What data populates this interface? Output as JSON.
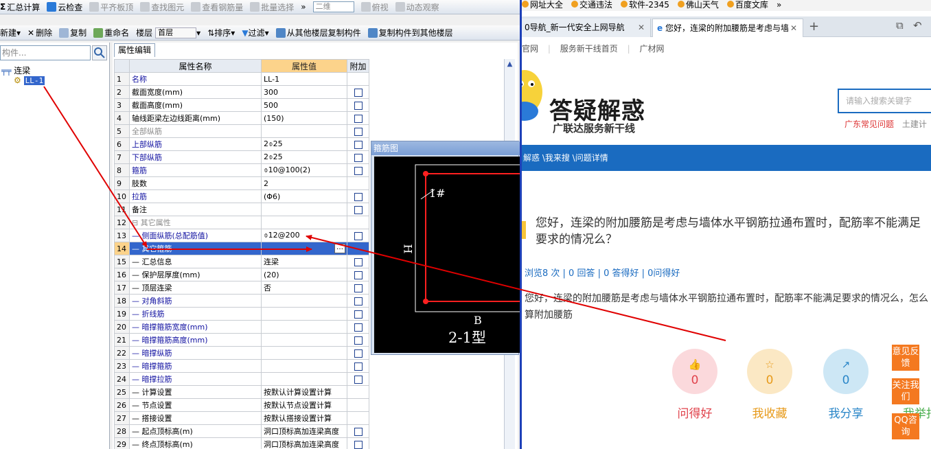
{
  "toolbar1": {
    "summary_calc": "汇总计算",
    "cloud_check": "云检查",
    "align_slab_top": "平齐板顶",
    "find_element": "查找图元",
    "view_rebar": "查看钢筋量",
    "batch_select": "批量选择",
    "more": "»",
    "view_mode": "二维",
    "top_view": "俯视",
    "dynamic_view": "动态观察"
  },
  "toolbar2": {
    "new": "新建",
    "delete": "删除",
    "copy": "复制",
    "rename": "重命名",
    "floor_label": "楼层",
    "floor_value": "首层",
    "sort": "排序",
    "filter": "过滤",
    "copy_from_floor": "从其他楼层复制构件",
    "copy_to_floor": "复制构件到其他楼层"
  },
  "tree": {
    "search_placeholder": "构件...",
    "root": "连梁",
    "child": "LL-1"
  },
  "property_editor": {
    "tab": "属性编辑",
    "headers": {
      "name": "属性名称",
      "value": "属性值",
      "extra": "附加"
    },
    "rows": [
      {
        "num": "1",
        "name": "名称",
        "value": "LL-1",
        "style": "blue",
        "check": false
      },
      {
        "num": "2",
        "name": "截面宽度(mm)",
        "value": "300",
        "style": "",
        "check": true
      },
      {
        "num": "3",
        "name": "截面高度(mm)",
        "value": "500",
        "style": "",
        "check": true
      },
      {
        "num": "4",
        "name": "轴线距梁左边线距离(mm)",
        "value": "(150)",
        "style": "",
        "check": true
      },
      {
        "num": "5",
        "name": "全部纵筋",
        "value": "",
        "style": "gray",
        "check": true
      },
      {
        "num": "6",
        "name": "上部纵筋",
        "value": "2⌽25",
        "style": "blue",
        "check": true
      },
      {
        "num": "7",
        "name": "下部纵筋",
        "value": "2⌽25",
        "style": "blue",
        "check": true
      },
      {
        "num": "8",
        "name": "箍筋",
        "value": "⌽10@100(2)",
        "style": "blue",
        "check": true
      },
      {
        "num": "9",
        "name": "肢数",
        "value": "2",
        "style": "",
        "check": false
      },
      {
        "num": "10",
        "name": "拉筋",
        "value": "(Φ6)",
        "style": "blue",
        "check": true
      },
      {
        "num": "11",
        "name": "备注",
        "value": "",
        "style": "",
        "check": true
      },
      {
        "num": "12",
        "name": "⊟ 其它属性",
        "value": "",
        "style": "gray",
        "check": false
      },
      {
        "num": "13",
        "name": "— 侧面纵筋(总配筋值)",
        "value": "⌽12@200",
        "style": "blue",
        "check": true
      },
      {
        "num": "14",
        "name": "— 其它箍筋",
        "value": "",
        "style": "hl",
        "check": false
      },
      {
        "num": "15",
        "name": "— 汇总信息",
        "value": "连梁",
        "style": "",
        "check": true
      },
      {
        "num": "16",
        "name": "— 保护层厚度(mm)",
        "value": "(20)",
        "style": "",
        "check": true
      },
      {
        "num": "17",
        "name": "— 顶层连梁",
        "value": "否",
        "style": "",
        "check": true
      },
      {
        "num": "18",
        "name": "— 对角斜筋",
        "value": "",
        "style": "blue",
        "check": true
      },
      {
        "num": "19",
        "name": "— 折线筋",
        "value": "",
        "style": "blue",
        "check": true
      },
      {
        "num": "20",
        "name": "— 暗撑箍筋宽度(mm)",
        "value": "",
        "style": "blue",
        "check": true
      },
      {
        "num": "21",
        "name": "— 暗撑箍筋高度(mm)",
        "value": "",
        "style": "blue",
        "check": true
      },
      {
        "num": "22",
        "name": "— 暗撑纵筋",
        "value": "",
        "style": "blue",
        "check": true
      },
      {
        "num": "23",
        "name": "— 暗撑箍筋",
        "value": "",
        "style": "blue",
        "check": true
      },
      {
        "num": "24",
        "name": "— 暗撑拉筋",
        "value": "",
        "style": "blue",
        "check": true
      },
      {
        "num": "25",
        "name": "— 计算设置",
        "value": "按默认计算设置计算",
        "style": "",
        "check": false
      },
      {
        "num": "26",
        "name": "— 节点设置",
        "value": "按默认节点设置计算",
        "style": "",
        "check": false
      },
      {
        "num": "27",
        "name": "— 搭接设置",
        "value": "按默认搭接设置计算",
        "style": "",
        "check": false
      },
      {
        "num": "28",
        "name": "— 起点顶标高(m)",
        "value": "洞口顶标高加连梁高度",
        "style": "",
        "check": true
      },
      {
        "num": "29",
        "name": "— 终点顶标高(m)",
        "value": "洞口顶标高加连梁高度",
        "style": "",
        "check": true
      }
    ],
    "ellipsis": "…"
  },
  "stirrup": {
    "title": "箍筋图",
    "label_1": "1#",
    "label_h": "H",
    "label_b": "B",
    "type": "2-1型"
  },
  "browser": {
    "bookmarks": [
      "网址大全",
      "交通违法",
      "软件-2345",
      "佛山天气",
      "百度文库",
      "»"
    ],
    "tabs": [
      "0导航_新一代安全上网导航",
      "您好，连梁的附加腰筋是考虑与墙"
    ],
    "topnav": [
      "官网",
      "服务新干线首页",
      "广材网"
    ],
    "logo_title": "答疑解惑",
    "logo_sub": "广联达服务新干线",
    "search_placeholder": "请输入搜索关键字",
    "hot_links": [
      "广东常见问题",
      "土建计"
    ],
    "breadcrumb": "解惑 \\我来搜 \\问题详情",
    "question_title": "您好，连梁的附加腰筋是考虑与墙体水平钢筋拉通布置时，配筋率不能满足要求的情况么？",
    "stats": "浏览8 次 | 0 回答 | 0 答得好 | 0问得好",
    "body": "您好，连梁的附加腰筋是考虑与墙体水平钢筋拉通布置时，配筋率不能满足要求的情况么，怎么算附加腰筋",
    "actions": [
      {
        "label": "问得好",
        "count": "0",
        "color": "#e0424b",
        "bg": "#fbd9dc"
      },
      {
        "label": "我收藏",
        "count": "0",
        "color": "#e79a1a",
        "bg": "#fbe8c4"
      },
      {
        "label": "我分享",
        "count": "0",
        "color": "#2a86c8",
        "bg": "#cde7f5"
      }
    ],
    "float_buttons": [
      "意见反馈",
      "关注我们",
      "QQ咨询"
    ],
    "partial_action": "我举报"
  }
}
